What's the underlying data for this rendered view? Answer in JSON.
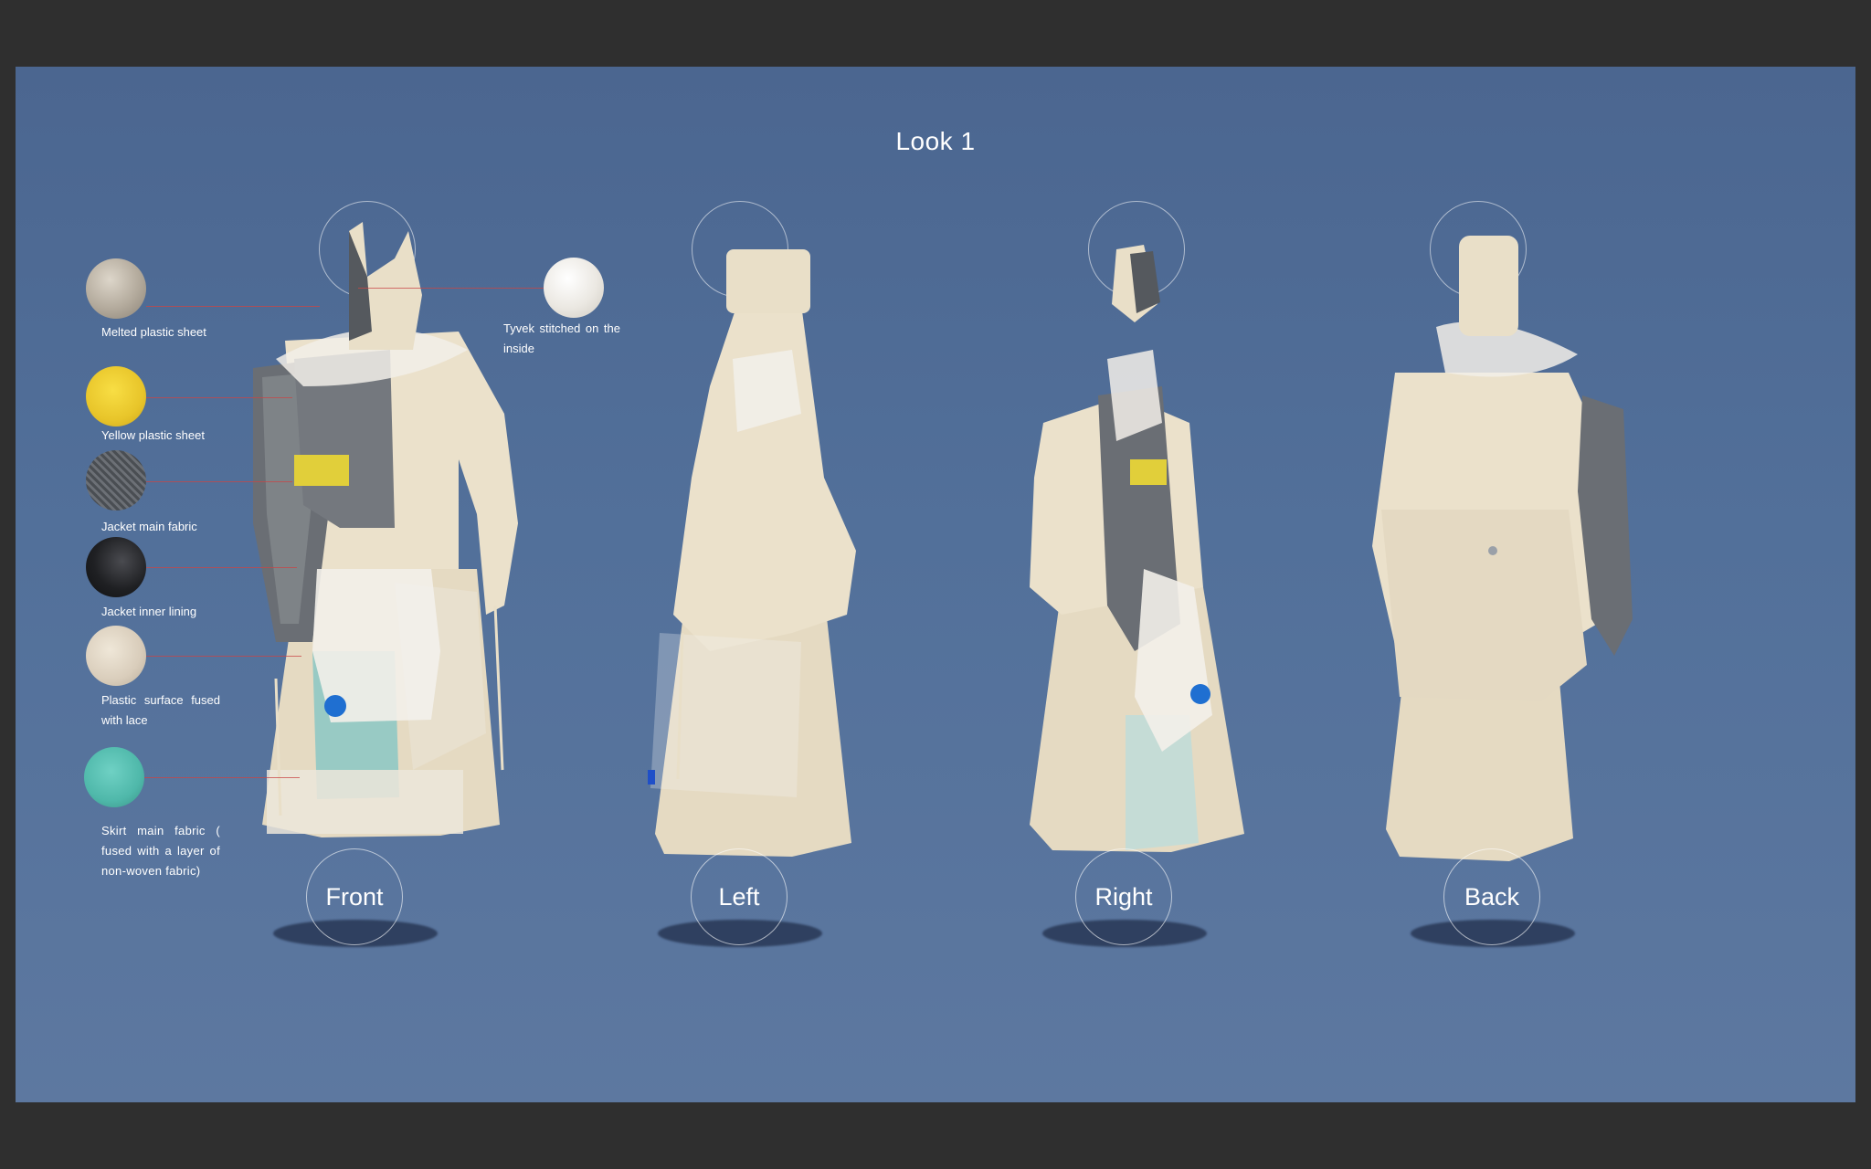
{
  "title": "Look 1",
  "views": [
    {
      "label": "Front"
    },
    {
      "label": "Left"
    },
    {
      "label": "Right"
    },
    {
      "label": "Back"
    }
  ],
  "materials": [
    {
      "label": "Melted plastic sheet",
      "color": "#b3aa9c"
    },
    {
      "label": "Yellow plastic sheet",
      "color": "#ecc92c"
    },
    {
      "label": "Jacket main fabric",
      "color": "#55595e"
    },
    {
      "label": "Jacket inner lining",
      "color": "#202124"
    },
    {
      "label": "Plastic surface fused with lace",
      "color": "#d9cdbb"
    },
    {
      "label": "Skirt main fabric ( fused with a layer of non-woven fabric)",
      "color": "#4fb8aa"
    },
    {
      "label": "Tyvek stitched on the inside",
      "color": "#ebe8e2"
    }
  ],
  "colors": {
    "background": "#2f2f2f",
    "slide": "#52709a",
    "garment_base": "#e9dfc8",
    "leader_line": "#c84646"
  }
}
